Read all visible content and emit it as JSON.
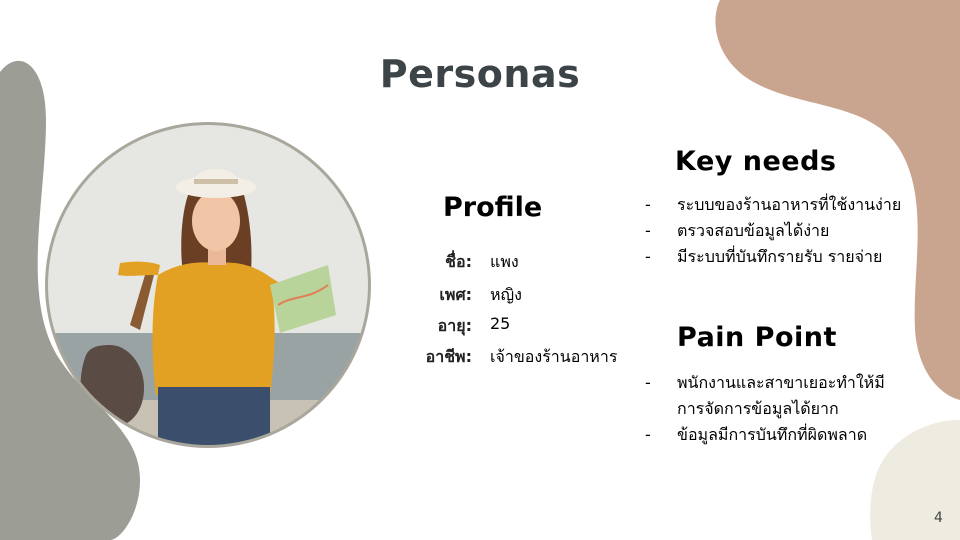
{
  "slide": {
    "title": "Personas",
    "page_number": "4"
  },
  "profile": {
    "heading": "Profile",
    "fields": [
      {
        "label": "ชื่อ:",
        "value": "แพง"
      },
      {
        "label": "เพศ:",
        "value": "หญิง"
      },
      {
        "label": "อายุ:",
        "value": "25"
      },
      {
        "label": "อาชีพ:",
        "value": "เจ้าของร้านอาหาร"
      }
    ]
  },
  "key_needs": {
    "heading": "Key needs",
    "items": [
      {
        "dash": "-",
        "text": "ระบบของร้านอาหารที่ใช้งานง่าย"
      },
      {
        "dash": "-",
        "text": "ตรวจสอบข้อมูลได้ง่าย"
      },
      {
        "dash": "-",
        "text": "มีระบบที่บันทึกรายรับ รายจ่าย"
      }
    ]
  },
  "pain_point": {
    "heading": "Pain Point",
    "items": [
      {
        "dash": "-",
        "line1": "พนักงานและสาขาเยอะทำให้มี",
        "line2": "การจัดการข้อมูลได้ยาก"
      },
      {
        "dash": "-",
        "line1": "ข้อมูลมีการบันทึกที่ผิดพลาด"
      }
    ]
  },
  "colors": {
    "title": "#3d4448",
    "blob_gray": "#9c9d94",
    "blob_tan": "#c9a48f",
    "blob_cream": "#eeebe0"
  }
}
